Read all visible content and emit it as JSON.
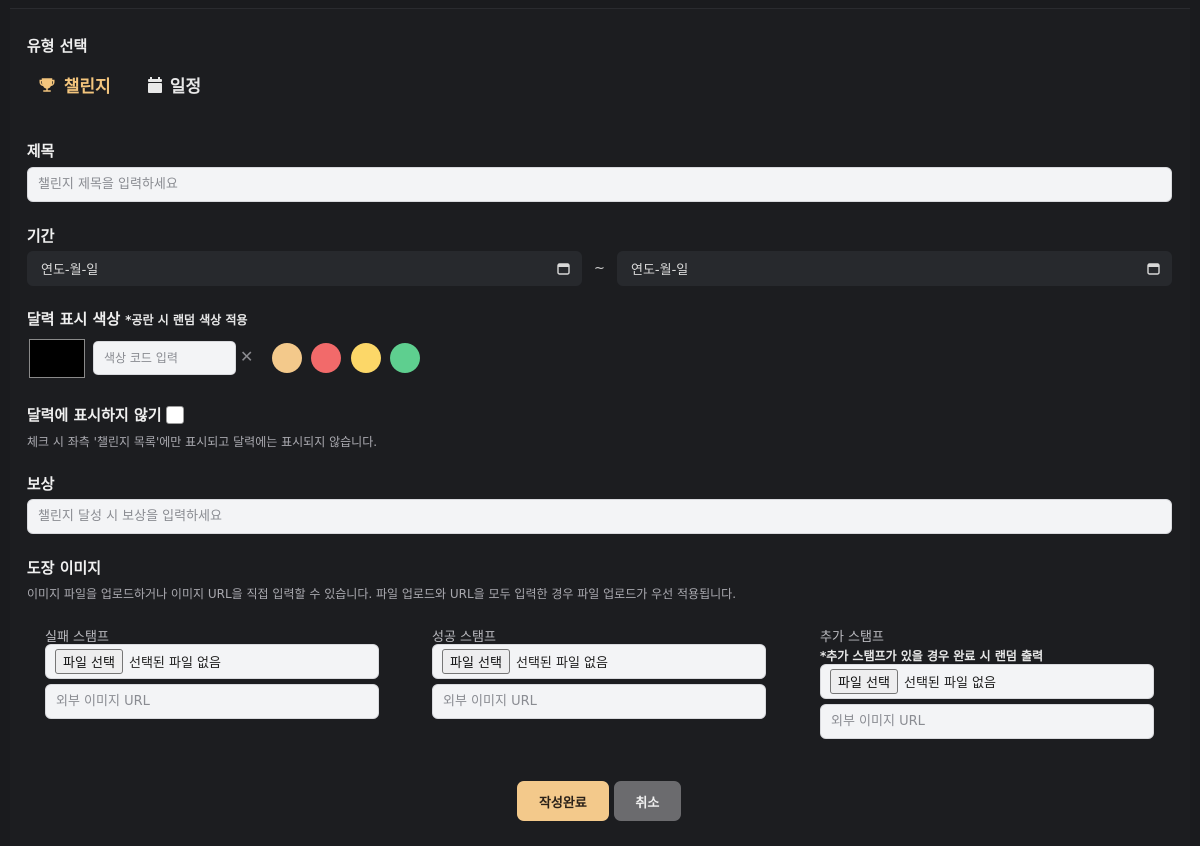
{
  "type_section": {
    "label": "유형 선택",
    "tabs": [
      {
        "label": "챌린지",
        "icon": "trophy-icon",
        "active": true
      },
      {
        "label": "일정",
        "icon": "calendar-icon",
        "active": false
      }
    ]
  },
  "title_field": {
    "label": "제목",
    "placeholder": "챌린지 제목을 입력하세요",
    "value": ""
  },
  "period": {
    "label": "기간",
    "start_placeholder": "연도-월-일",
    "end_placeholder": "연도-월-일",
    "separator": "~"
  },
  "color_section": {
    "label": "달력 표시 색상",
    "note": "*공란 시 랜덤 색상 적용",
    "code_placeholder": "색상 코드 입력",
    "current_color": "#000000",
    "clear_symbol": "✕",
    "presets": [
      "#f3c98b",
      "#f26a6a",
      "#fcd768",
      "#5ecf8f"
    ]
  },
  "hide_section": {
    "label": "달력에 표시하지 않기",
    "checked": false,
    "description": "체크 시 좌측 '챌린지 목록'에만 표시되고 달력에는 표시되지 않습니다."
  },
  "reward_field": {
    "label": "보상",
    "placeholder": "챌린지 달성 시 보상을 입력하세요"
  },
  "stamp_section": {
    "label": "도장 이미지",
    "description": "이미지 파일을 업로드하거나 이미지 URL을 직접 입력할 수 있습니다. 파일 업로드와 URL을 모두 입력한 경우 파일 업로드가 우선 적용됩니다.",
    "file_button": "파일 선택",
    "no_file": "선택된 파일 없음",
    "url_placeholder": "외부 이미지 URL",
    "fail_title": "실패 스탬프",
    "success_title": "성공 스탬프",
    "extra_title": "추가 스탬프",
    "extra_note": "*추가 스탬프가 있을 경우 완료 시 랜덤 출력"
  },
  "actions": {
    "submit": "작성완료",
    "cancel": "취소",
    "submit_color": "#f3c98b",
    "cancel_color": "#6b6b6e"
  }
}
